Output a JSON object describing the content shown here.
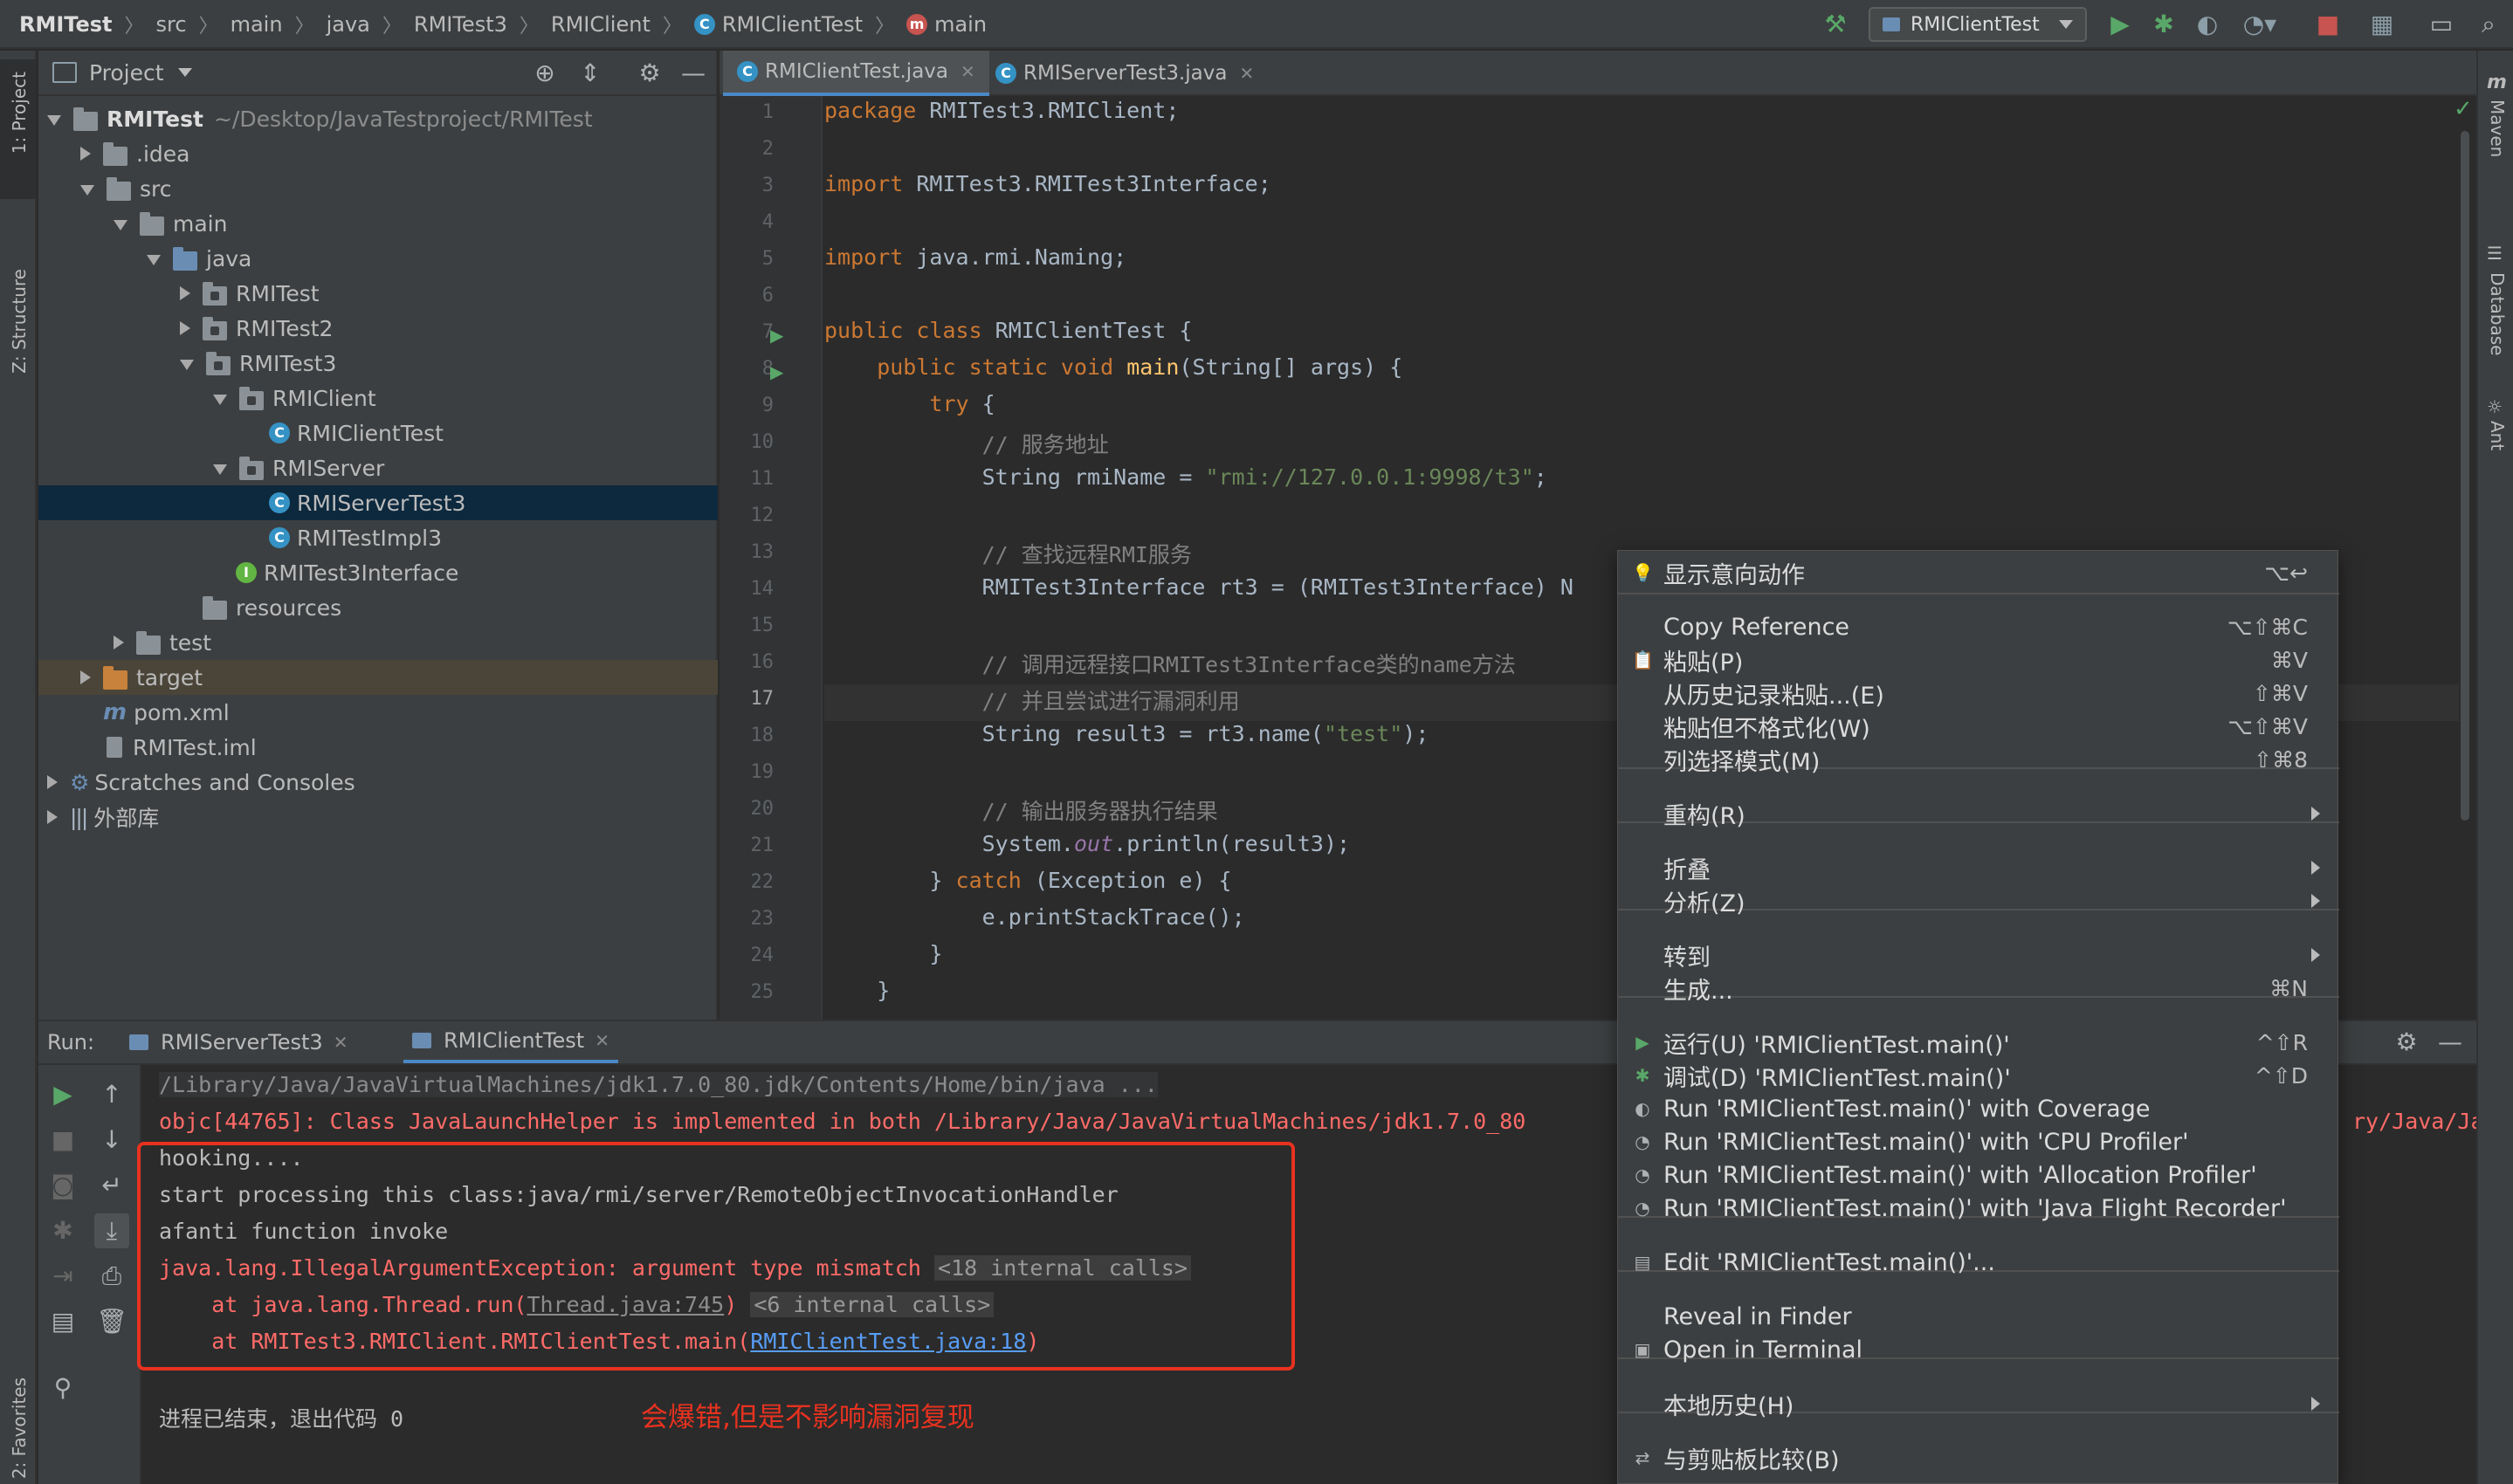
{
  "breadcrumb": {
    "items": [
      "RMITest",
      "src",
      "main",
      "java",
      "RMITest3",
      "RMIClient",
      "RMIClientTest",
      "main"
    ]
  },
  "toolbar": {
    "run_config": "RMIClientTest",
    "icons": [
      "hammer-icon",
      "run-icon",
      "debug-icon",
      "coverage-icon",
      "profile-icon",
      "stop-icon",
      "project-structure-icon",
      "layout-icon",
      "search-icon"
    ]
  },
  "left_strip": {
    "project_label": "1: Project",
    "structure_label": "Z: Structure",
    "favorites_label": "2: Favorites"
  },
  "right_strip": {
    "maven_label": "Maven",
    "database_label": "Database",
    "ant_label": "Ant"
  },
  "project": {
    "title": "Project",
    "tree": [
      {
        "label": "RMITest",
        "path": "~/Desktop/JavaTestproject/RMITest",
        "icon": "module-folder-icon"
      },
      {
        "label": ".idea",
        "icon": "folder-icon"
      },
      {
        "label": "src",
        "icon": "folder-icon"
      },
      {
        "label": "main",
        "icon": "folder-icon"
      },
      {
        "label": "java",
        "icon": "source-folder-icon"
      },
      {
        "label": "RMITest",
        "icon": "package-icon"
      },
      {
        "label": "RMITest2",
        "icon": "package-icon"
      },
      {
        "label": "RMITest3",
        "icon": "package-icon"
      },
      {
        "label": "RMIClient",
        "icon": "package-icon"
      },
      {
        "label": "RMIClientTest",
        "icon": "class-icon"
      },
      {
        "label": "RMIServer",
        "icon": "package-icon"
      },
      {
        "label": "RMIServerTest3",
        "icon": "class-icon"
      },
      {
        "label": "RMITestImpl3",
        "icon": "class-icon"
      },
      {
        "label": "RMITest3Interface",
        "icon": "interface-icon"
      },
      {
        "label": "resources",
        "icon": "resources-folder-icon"
      },
      {
        "label": "test",
        "icon": "folder-icon"
      },
      {
        "label": "target",
        "icon": "excluded-folder-icon"
      },
      {
        "label": "pom.xml",
        "icon": "maven-icon"
      },
      {
        "label": "RMITest.iml",
        "icon": "iml-file-icon"
      },
      {
        "label": "Scratches and Consoles",
        "icon": "scratches-icon"
      },
      {
        "label": "外部库",
        "icon": "libraries-icon"
      }
    ]
  },
  "editor": {
    "tabs": [
      "RMIClientTest.java",
      "RMIServerTest3.java"
    ],
    "current_line": 17,
    "line_numbers": [
      "1",
      "2",
      "3",
      "4",
      "5",
      "6",
      "7",
      "8",
      "9",
      "10",
      "11",
      "12",
      "13",
      "14",
      "15",
      "16",
      "17",
      "18",
      "19",
      "20",
      "21",
      "22",
      "23",
      "24",
      "25"
    ],
    "code": {
      "l1_kw": "package",
      "l1_rest": " RMITest3.RMIClient;",
      "l3_kw": "import",
      "l3_rest": " RMITest3.RMITest3Interface;",
      "l5_kw": "import",
      "l5_rest": " java.rmi.Naming;",
      "l7_kw": "public class",
      "l7_rest": " RMIClientTest {",
      "l8_kw": "    public static void",
      "l8_fn": " main",
      "l8_rest": "(String[] args) {",
      "l9_kw": "        try",
      "l9_rest": " {",
      "l10_cm": "            // 服务地址",
      "l11_a": "            String rmiName = ",
      "l11_str": "\"rmi://127.0.0.1:9998/t3\"",
      "l11_b": ";",
      "l13_cm": "            // 查找远程RMI服务",
      "l14": "            RMITest3Interface rt3 = (RMITest3Interface) N",
      "l16_cm": "            // 调用远程接口RMITest3Interface类的name方法",
      "l17_cm": "            // 并且尝试进行漏洞利用",
      "l18_a": "            String result3 = rt3.name(",
      "l18_str": "\"test\"",
      "l18_b": ");",
      "l20_cm": "            // 输出服务器执行结果",
      "l21_a": "            System.",
      "l21_it": "out",
      "l21_b": ".println(result3);",
      "l22_a": "        } ",
      "l22_kw": "catch",
      "l22_b": " (Exception e) {",
      "l23": "            e.printStackTrace();",
      "l24": "        }",
      "l25": "    }"
    }
  },
  "run": {
    "label": "Run:",
    "tabs": [
      "RMIServerTest3",
      "RMIClientTest"
    ],
    "console": {
      "cmd": "/Library/Java/JavaVirtualMachines/jdk1.7.0_80.jdk/Contents/Home/bin/java ...",
      "objc_left": "objc[44765]: Class JavaLaunchHelper is implemented in both /Library/Java/JavaVirtualMachines/jdk1.7.0_80",
      "objc_right": "ry/Java/Ja",
      "hooking": "hooking....",
      "start": "start processing this class:java/rmi/server/RemoteObjectInvocationHandler",
      "afanti": "afanti function invoke",
      "exc": "java.lang.IllegalArgumentException: argument type mismatch",
      "exc_internal": "<18 internal calls>",
      "at1_a": "    at java.lang.Thread.run(",
      "at1_link": "Thread.java:745",
      "at1_b": ")",
      "at1_internal": "<6 internal calls>",
      "at2_a": "    at RMITest3.RMIClient.RMIClientTest.main(",
      "at2_link": "RMIClientTest.java:18",
      "at2_b": ")",
      "exit": "进程已结束，退出代码 0"
    },
    "annotation": "会爆错,但是不影响漏洞复现"
  },
  "context_menu": {
    "items": [
      {
        "label": "显示意向动作",
        "shortcut": "⌥↩",
        "icon": "lightbulb-icon"
      },
      {
        "label": "Copy Reference",
        "shortcut": "⌥⇧⌘C"
      },
      {
        "label": "粘贴(P)",
        "shortcut": "⌘V",
        "icon": "paste-icon"
      },
      {
        "label": "从历史记录粘贴...(E)",
        "shortcut": "⇧⌘V"
      },
      {
        "label": "粘贴但不格式化(W)",
        "shortcut": "⌥⇧⌘V"
      },
      {
        "label": "列选择模式(M)",
        "shortcut": "⇧⌘8"
      },
      {
        "label": "重构(R)",
        "submenu": true
      },
      {
        "label": "折叠",
        "submenu": true
      },
      {
        "label": "分析(Z)",
        "submenu": true
      },
      {
        "label": "转到",
        "submenu": true
      },
      {
        "label": "生成...",
        "shortcut": "⌘N"
      },
      {
        "label": "运行(U) 'RMIClientTest.main()'",
        "shortcut": "^⇧R",
        "icon": "run-icon"
      },
      {
        "label": "调试(D) 'RMIClientTest.main()'",
        "shortcut": "^⇧D",
        "icon": "debug-icon"
      },
      {
        "label": "Run 'RMIClientTest.main()' with Coverage",
        "icon": "coverage-icon"
      },
      {
        "label": "Run 'RMIClientTest.main()' with 'CPU Profiler'",
        "icon": "profiler-icon"
      },
      {
        "label": "Run 'RMIClientTest.main()' with 'Allocation Profiler'",
        "icon": "profiler-icon"
      },
      {
        "label": "Run 'RMIClientTest.main()' with 'Java Flight Recorder'",
        "icon": "profiler-icon"
      },
      {
        "label": "Edit 'RMIClientTest.main()'...",
        "icon": "edit-config-icon"
      },
      {
        "label": "Reveal in Finder"
      },
      {
        "label": "Open in Terminal",
        "icon": "terminal-icon"
      },
      {
        "label": "本地历史(H)",
        "submenu": true
      },
      {
        "label": "与剪贴板比较(B)",
        "icon": "compare-icon"
      }
    ]
  },
  "colors": {
    "accent": "#4a88c7",
    "error": "#ff6b68",
    "annotation": "#e8321f",
    "keyword": "#cc7832",
    "string": "#6a8759",
    "comment": "#808080"
  }
}
